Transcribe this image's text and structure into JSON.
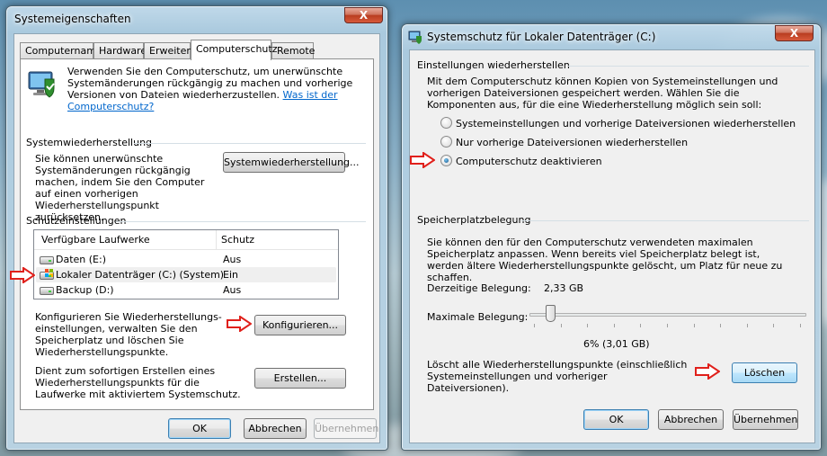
{
  "left_window": {
    "title": "Systemeigenschaften",
    "close_label": "X",
    "tabs": [
      "Computername",
      "Hardware",
      "Erweitert",
      "Computerschutz",
      "Remote"
    ],
    "intro_text": "Verwenden Sie den Computerschutz, um unerwünschte Systemänderungen rückgängig zu machen und vorherige Versionen von Dateien wiederherzustellen.",
    "intro_link": "Was ist der Computerschutz?",
    "restore": {
      "heading": "Systemwiederherstellung",
      "text": "Sie können unerwünschte Systemänderungen rückgängig machen, indem Sie den Computer auf einen vorherigen Wiederherstellungspunkt zurücksetzen.",
      "button": "Systemwiederherstellung..."
    },
    "protection": {
      "heading": "Schutzeinstellungen",
      "col_drives": "Verfügbare Laufwerke",
      "col_protection": "Schutz",
      "rows": [
        {
          "drive": "Daten (E:)",
          "status": "Aus"
        },
        {
          "drive": "Lokaler Datenträger (C:) (System)",
          "status": "Ein"
        },
        {
          "drive": "Backup (D:)",
          "status": "Aus"
        }
      ],
      "configure_text": "Konfigurieren Sie Wiederherstellungs- einstellungen, verwalten Sie den Speicherplatz und löschen Sie Wiederherstellungspunkte.",
      "configure_button": "Konfigurieren...",
      "create_text": "Dient zum sofortigen Erstellen eines Wiederherstellungspunkts für die Laufwerke mit aktiviertem Systemschutz.",
      "create_button": "Erstellen..."
    },
    "buttons": {
      "ok": "OK",
      "cancel": "Abbrechen",
      "apply": "Übernehmen"
    }
  },
  "right_window": {
    "title": "Systemschutz für Lokaler Datenträger (C:)",
    "close_label": "X",
    "restore_settings": {
      "heading": "Einstellungen wiederherstellen",
      "text": "Mit dem Computerschutz können Kopien von Systemeinstellungen und vorherigen Dateiversionen gespeichert werden. Wählen Sie die Komponenten aus, für die eine Wiederherstellung möglich sein soll:",
      "options": [
        {
          "label": "Systemeinstellungen und vorherige Dateiversionen wiederherstellen",
          "checked": false
        },
        {
          "label": "Nur vorherige Dateiversionen wiederherstellen",
          "checked": false
        },
        {
          "label": "Computerschutz deaktivieren",
          "checked": true
        }
      ]
    },
    "disk_usage": {
      "heading": "Speicherplatzbelegung",
      "text": "Sie können den für den Computerschutz verwendeten maximalen Speicherplatz anpassen. Wenn bereits viel Speicherplatz belegt ist, werden ältere Wiederherstellungspunkte gelöscht, um Platz für neue zu schaffen.",
      "current_label": "Derzeitige Belegung:",
      "current_value": "2,33 GB",
      "max_label": "Maximale Belegung:",
      "max_fraction": 0.06,
      "max_value_text": "6% (3,01 GB)",
      "delete_text": "Löscht alle Wiederherstellungspunkte (einschließlich Systemeinstellungen und vorheriger Dateiversionen).",
      "delete_button": "Löschen"
    },
    "buttons": {
      "ok": "OK",
      "cancel": "Abbrechen",
      "apply": "Übernehmen"
    }
  },
  "colors": {
    "annotation_arrow": "#e0201b",
    "link": "#0066cc",
    "window_frame": "#b9d3e4"
  }
}
